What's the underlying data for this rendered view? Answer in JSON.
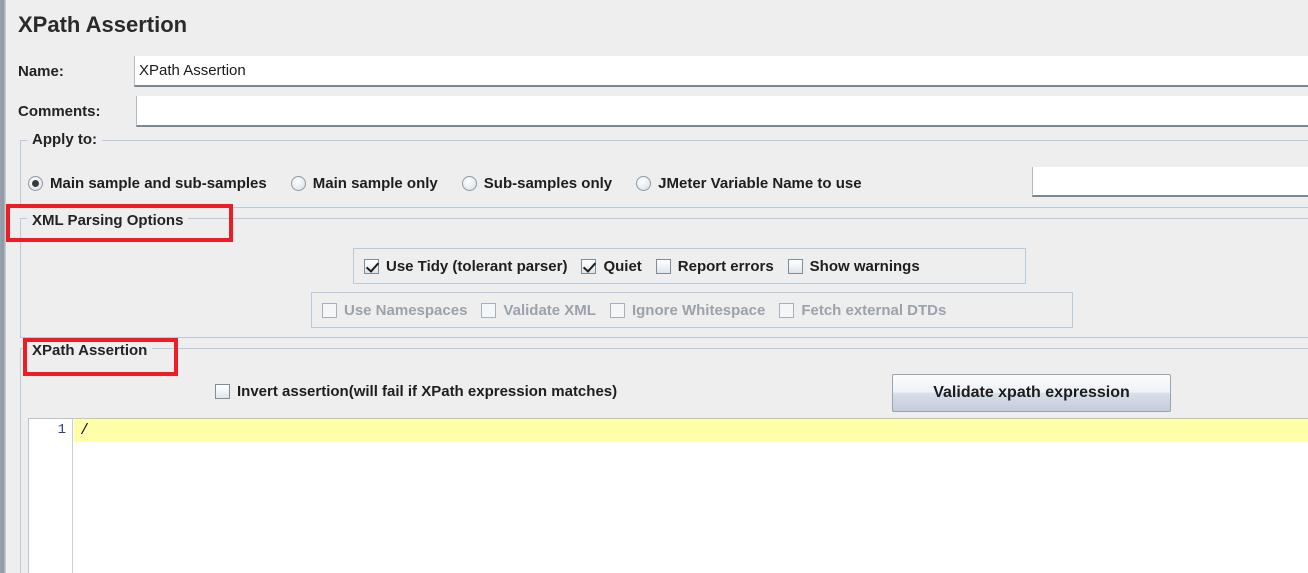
{
  "window": {
    "title": "XPath Assertion"
  },
  "fields": {
    "name_label": "Name:",
    "name_value": "XPath Assertion",
    "comments_label": "Comments:",
    "comments_value": "",
    "comments_placeholder": ""
  },
  "apply_to": {
    "title": "Apply to:",
    "options": [
      {
        "label": "Main sample and sub-samples",
        "checked": true
      },
      {
        "label": "Main sample only",
        "checked": false
      },
      {
        "label": "Sub-samples only",
        "checked": false
      },
      {
        "label": "JMeter Variable Name to use",
        "checked": false
      }
    ],
    "variable_value": "",
    "variable_placeholder": ""
  },
  "xml_parsing": {
    "title": "XML Parsing Options",
    "row1": [
      {
        "label": "Use Tidy (tolerant parser)",
        "checked": true,
        "enabled": true
      },
      {
        "label": "Quiet",
        "checked": true,
        "enabled": true
      },
      {
        "label": "Report errors",
        "checked": false,
        "enabled": true
      },
      {
        "label": "Show warnings",
        "checked": false,
        "enabled": true
      }
    ],
    "row2": [
      {
        "label": "Use Namespaces",
        "checked": false,
        "enabled": false
      },
      {
        "label": "Validate XML",
        "checked": false,
        "enabled": false
      },
      {
        "label": "Ignore Whitespace",
        "checked": false,
        "enabled": false
      },
      {
        "label": "Fetch external DTDs",
        "checked": false,
        "enabled": false
      }
    ]
  },
  "xpath_assertion": {
    "title": "XPath Assertion",
    "invert_label": "Invert assertion(will fail if XPath expression matches)",
    "invert_checked": false,
    "validate_button_label": "Validate xpath expression",
    "editor": {
      "line_number": "1",
      "expression": "/"
    }
  },
  "colors": {
    "panel_background": "#eeeeee",
    "panel_border": "#b8cade",
    "field_underline": "#7b8793",
    "annotation_red": "#ee1c25",
    "active_line": "#ffffaa",
    "gutter_number": "#2b3f9e"
  }
}
